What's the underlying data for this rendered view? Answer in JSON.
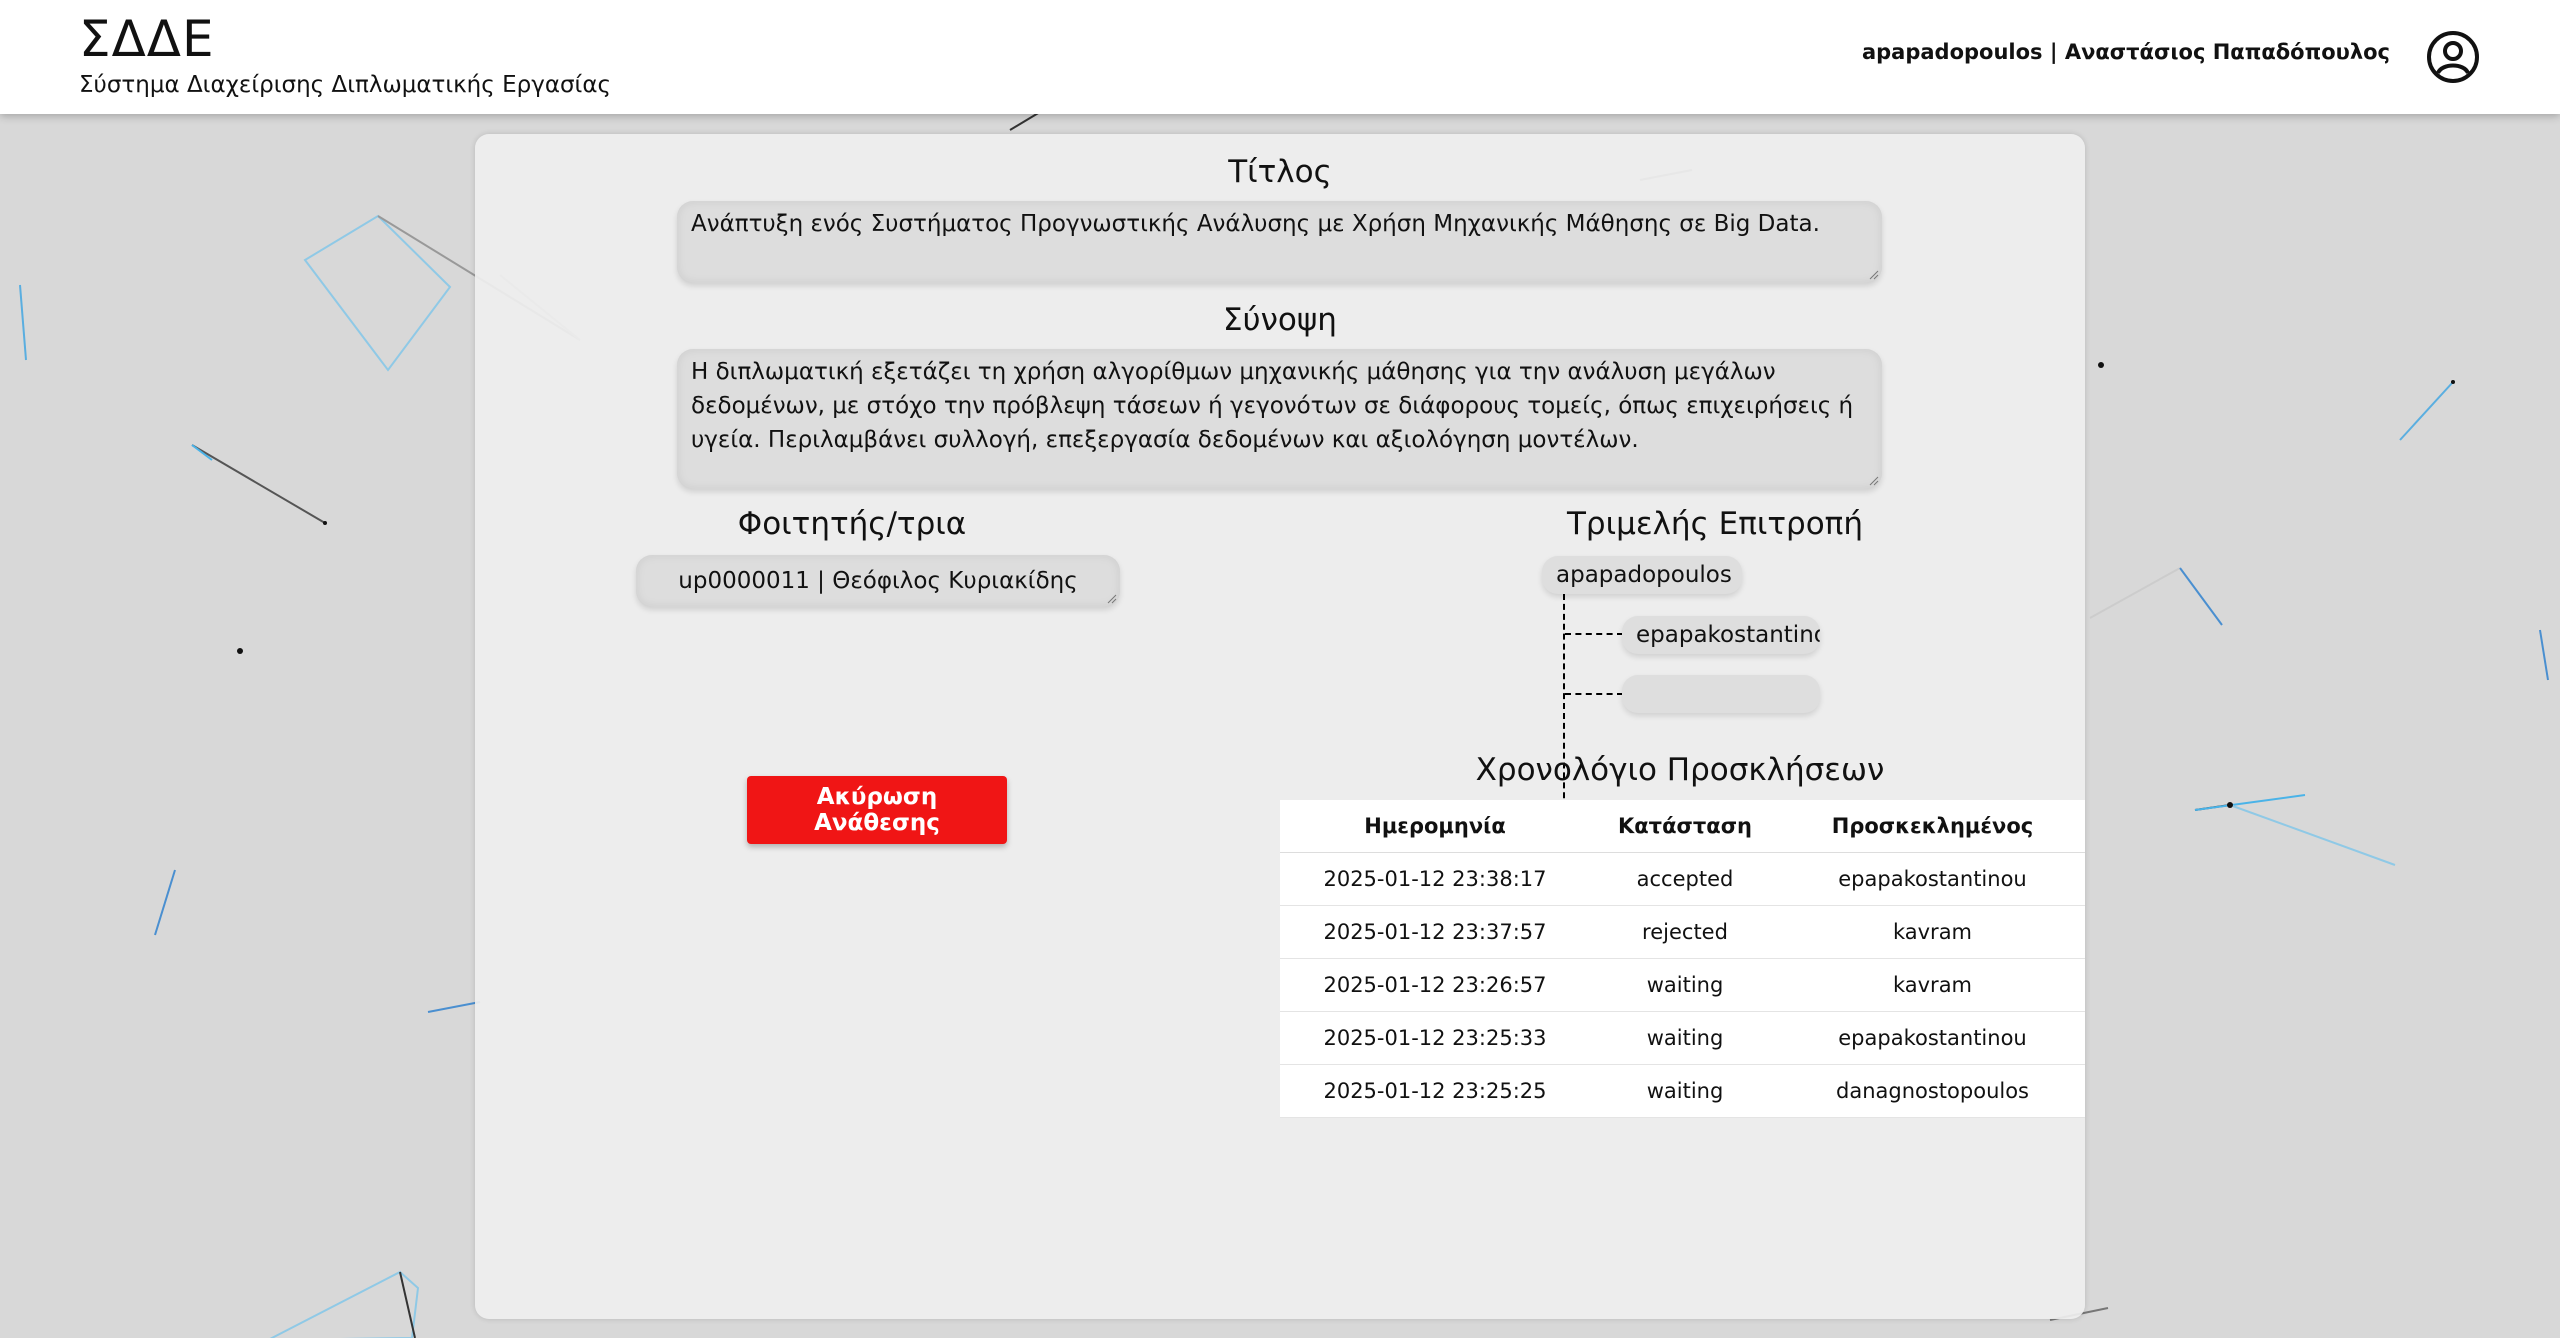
{
  "header": {
    "app_title": "ΣΔΔΕ",
    "app_subtitle": "Σύστημα Διαχείρισης Διπλωματικής Εργασίας",
    "user_label": "apapadopoulos | Αναστάσιος Παπαδόπουλος",
    "avatar_icon": "user-circle-icon"
  },
  "form": {
    "title_heading": "Τίτλος",
    "title_value": "Ανάπτυξη ενός Συστήματος Προγνωστικής Ανάλυσης με Χρήση Μηχανικής Μάθησης σε Big Data.",
    "summary_heading": "Σύνοψη",
    "summary_value": "Η διπλωματική εξετάζει τη χρήση αλγορίθμων μηχανικής μάθησης για την ανάλυση μεγάλων δεδομένων, με στόχο την πρόβλεψη τάσεων ή γεγονότων σε διάφορους τομείς, όπως επιχειρήσεις ή υγεία. Περιλαμβάνει συλλογή, επεξεργασία δεδομένων και αξιολόγηση μοντέλων.",
    "student_heading": "Φοιτητής/τρια",
    "student_value": "up0000011 | Θεόφιλος Κυριακίδης",
    "committee_heading": "Τριμελής Επιτροπή",
    "committee": {
      "supervisor": "apapadopoulos",
      "member_1": "epapakostantinou",
      "member_2": ""
    },
    "cancel_button": "Ακύρωση Ανάθεσης"
  },
  "history": {
    "heading": "Χρονολόγιο Προσκλήσεων",
    "columns": [
      "Ημερομηνία",
      "Κατάσταση",
      "Προσκεκλημένος"
    ],
    "rows": [
      {
        "date": "2025-01-12 23:38:17",
        "status": "accepted",
        "invitee": "epapakostantinou"
      },
      {
        "date": "2025-01-12 23:37:57",
        "status": "rejected",
        "invitee": "kavram"
      },
      {
        "date": "2025-01-12 23:26:57",
        "status": "waiting",
        "invitee": "kavram"
      },
      {
        "date": "2025-01-12 23:25:33",
        "status": "waiting",
        "invitee": "epapakostantinou"
      },
      {
        "date": "2025-01-12 23:25:25",
        "status": "waiting",
        "invitee": "danagnostopoulos"
      }
    ]
  },
  "colors": {
    "background": "#d8d8d8",
    "card": "#eeeeee",
    "danger": "#f01515",
    "accent_line": "#4ab3e8"
  }
}
